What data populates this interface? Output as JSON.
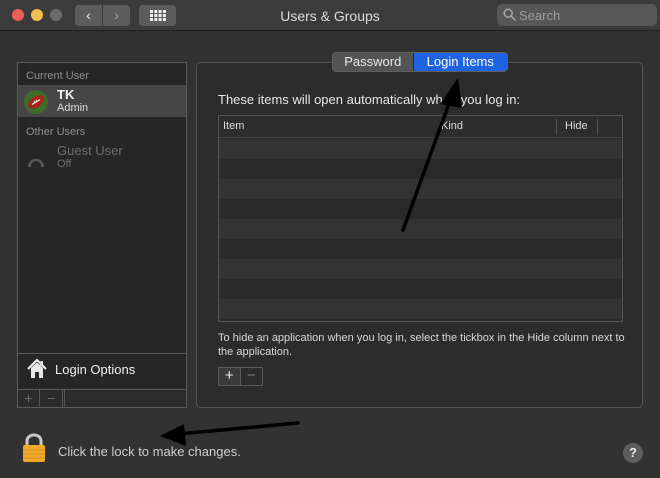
{
  "window": {
    "title": "Users & Groups"
  },
  "toolbar": {
    "back_glyph": "‹",
    "forward_glyph": "›",
    "show_all_icon": "grid-icon"
  },
  "search": {
    "placeholder": "Search",
    "icon": "search-icon"
  },
  "sidebar": {
    "current_user_label": "Current User",
    "other_users_label": "Other Users",
    "users": [
      {
        "name": "TK",
        "role": "Admin",
        "selected": true,
        "avatar": "football-avatar"
      },
      {
        "name": "Guest User",
        "role": "Off",
        "selected": false,
        "avatar": "guest-avatar"
      }
    ],
    "login_options_label": "Login Options",
    "add_glyph": "+",
    "remove_glyph": "−"
  },
  "tabs": [
    {
      "label": "Password",
      "active": false
    },
    {
      "label": "Login Items",
      "active": true
    }
  ],
  "login_items": {
    "intro": "These items will open automatically when you log in:",
    "columns": [
      "Item",
      "Kind",
      "Hide"
    ],
    "rows": [],
    "help_text": "To hide an application when you log in, select the tickbox in the Hide column next to the application.",
    "add_glyph": "+",
    "remove_glyph": "−"
  },
  "footer": {
    "lock_text": "Click the lock to make changes.",
    "help_glyph": "?"
  },
  "colors": {
    "accent": "#1f63e0",
    "window_bg": "#323232",
    "lock": "#f0a92b"
  }
}
